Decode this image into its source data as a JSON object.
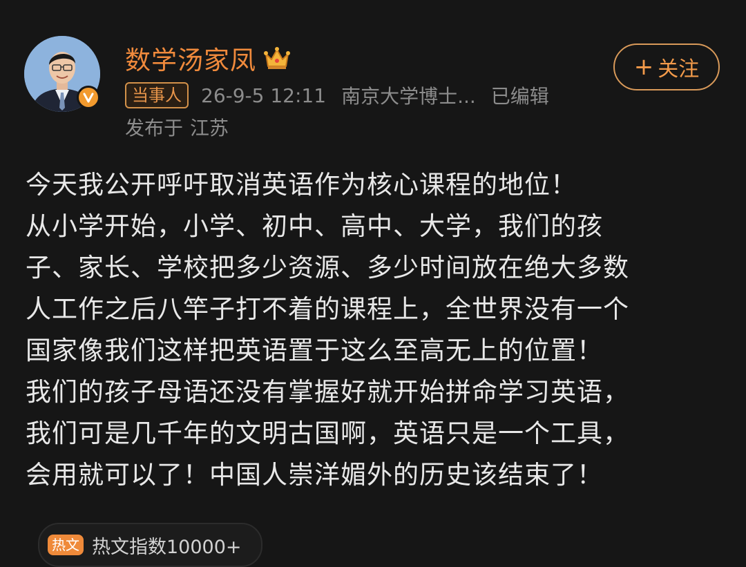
{
  "author": {
    "name": "数学汤家凤",
    "avatar_icon": "person-avatar",
    "verified_icon": "verified-v-icon",
    "crown_icon": "crown-icon"
  },
  "meta": {
    "badge": "当事人",
    "time": "26-9-5 12:11",
    "source": "南京大学博士...",
    "edited": "已编辑",
    "location_prefix": "发布于",
    "location": "江苏"
  },
  "follow": {
    "icon": "+",
    "label": "关注"
  },
  "content": {
    "lines": [
      "今天我公开呼吁取消英语作为核心课程的地位！",
      "从小学开始，小学、初中、高中、大学，我们的孩",
      "子、家长、学校把多少资源、多少时间放在绝大多数",
      "人工作之后八竿子打不着的课程上，全世界没有一个",
      "国家像我们这样把英语置于这么至高无上的位置！",
      "我们的孩子母语还没有掌握好就开始拼命学习英语，",
      "我们可是几千年的文明古国啊，英语只是一个工具，",
      "会用就可以了！中国人崇洋媚外的历史该结束了！"
    ]
  },
  "hot": {
    "icon_text": "热文",
    "label": "热文指数10000+"
  },
  "colors": {
    "background": "#161616",
    "accent": "#f08a3c",
    "text": "#e8e8e8",
    "muted": "#8c8c8c"
  }
}
